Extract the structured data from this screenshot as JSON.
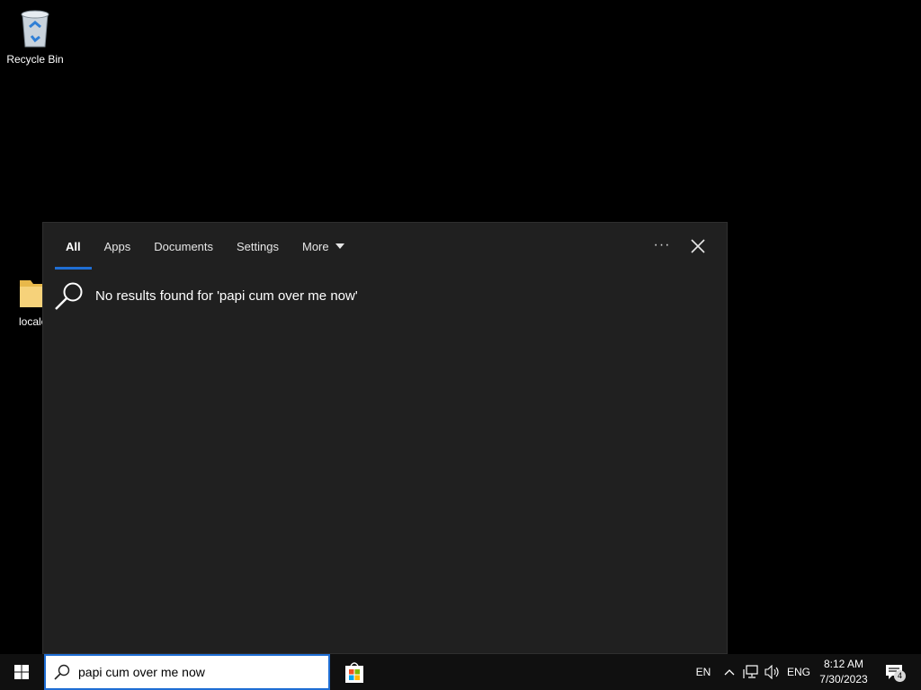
{
  "desktop": {
    "icons": [
      {
        "label": "Recycle Bin"
      },
      {
        "label": "locale"
      }
    ]
  },
  "search_panel": {
    "tabs": [
      {
        "label": "All",
        "active": true
      },
      {
        "label": "Apps"
      },
      {
        "label": "Documents"
      },
      {
        "label": "Settings"
      },
      {
        "label": "More"
      }
    ],
    "more_options_glyph": "···",
    "no_results_text": "No results found for 'papi cum over me now'"
  },
  "taskbar": {
    "search_value": "papi cum over me now",
    "input_language": "EN",
    "keyboard_language": "ENG",
    "clock_time": "8:12 AM",
    "clock_date": "7/30/2023",
    "notification_count": "4"
  },
  "colors": {
    "accent": "#1f6ed4",
    "panel_bg": "#202020",
    "taskbar_bg": "#101010"
  },
  "icons": [
    "recycle-bin-icon",
    "folder-icon",
    "search-icon",
    "close-icon",
    "windows-logo-icon",
    "store-icon",
    "chevron-up-icon",
    "network-icon",
    "volume-icon",
    "notification-icon"
  ]
}
